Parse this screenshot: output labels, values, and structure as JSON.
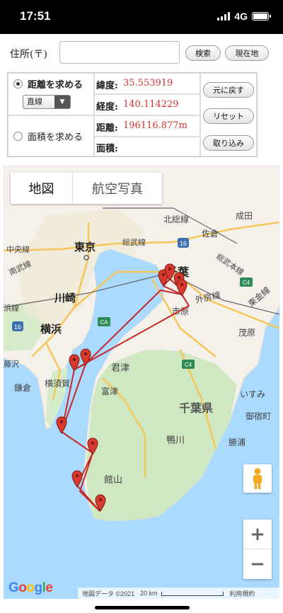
{
  "status_bar": {
    "time": "17:51",
    "network": "4G"
  },
  "address": {
    "label": "住所(〒)",
    "input_value": "",
    "search_button": "検索",
    "current_location_button": "現在地"
  },
  "measure": {
    "distance_label": "距離を求める",
    "area_label": "面積を求める",
    "mode_select": "直線",
    "latitude_label": "緯度:",
    "latitude_value": "35.553919",
    "longitude_label": "経度:",
    "longitude_value": "140.114229",
    "distance_label2": "距離:",
    "distance_value": "196116.877m",
    "area_label2": "面積:",
    "area_value": "",
    "undo_button": "元に戻す",
    "reset_button": "リセット",
    "import_button": "取り込み"
  },
  "map": {
    "tab_map": "地図",
    "tab_aerial": "航空写真",
    "labels": {
      "hokuso": "北総線",
      "narita": "成田",
      "sakura": "佐倉",
      "chuo": "中央線",
      "tokyo": "東京",
      "sobu": "総武線",
      "sobu_main": "総武本線",
      "nambu": "南武線",
      "chiba": "千葉",
      "kawasaki": "川崎",
      "sotobo": "外房線",
      "togane": "東金線",
      "hamakawa": "浜線",
      "ichihara": "市原",
      "yokohama": "横浜",
      "mobara": "茂原",
      "fujisawa": "藤沢",
      "kamakura": "鎌倉",
      "yokosuka": "横須賀",
      "kimitsu": "君津",
      "futtsu": "富津",
      "isumi": "いすみ",
      "onjuku": "御宿町",
      "chiba_pref": "千葉県",
      "kamogawa": "鴨川",
      "katsuura": "勝浦",
      "tateyama": "館山",
      "c4a": "C4",
      "c4b": "C4",
      "ca": "CA",
      "r16a": "16",
      "r16b": "16"
    },
    "route_color": "#c62828",
    "marker_color": "#d8392f",
    "footer_data": "地図データ ©2021",
    "footer_scale": "20 km",
    "footer_terms": "利用規約",
    "logo": "Google"
  }
}
